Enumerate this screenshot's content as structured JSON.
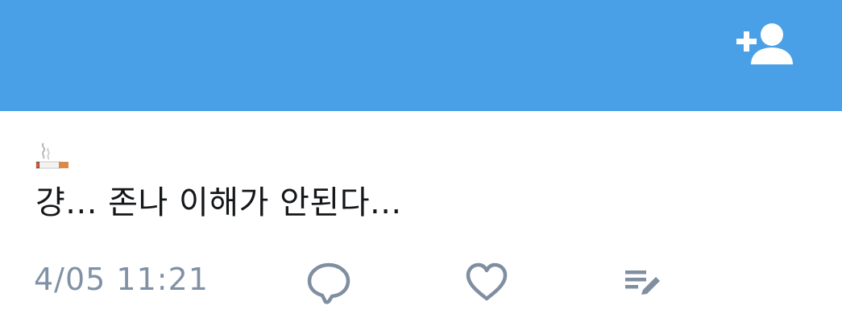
{
  "header": {
    "background_color": "#4aa0e6",
    "follow_icon": "add-user-icon"
  },
  "tweet": {
    "emoji_icon": "cigarette-icon",
    "text": "걍... 존나 이해가 안된다...",
    "timestamp": "4/05 11:21"
  },
  "actions": [
    {
      "name": "reply",
      "icon": "speech-bubble-icon"
    },
    {
      "name": "like",
      "icon": "heart-icon"
    },
    {
      "name": "note",
      "icon": "list-edit-icon"
    }
  ],
  "colors": {
    "text": "#14171a",
    "muted": "#8091a5",
    "icon_gray": "#7f8ea0"
  }
}
